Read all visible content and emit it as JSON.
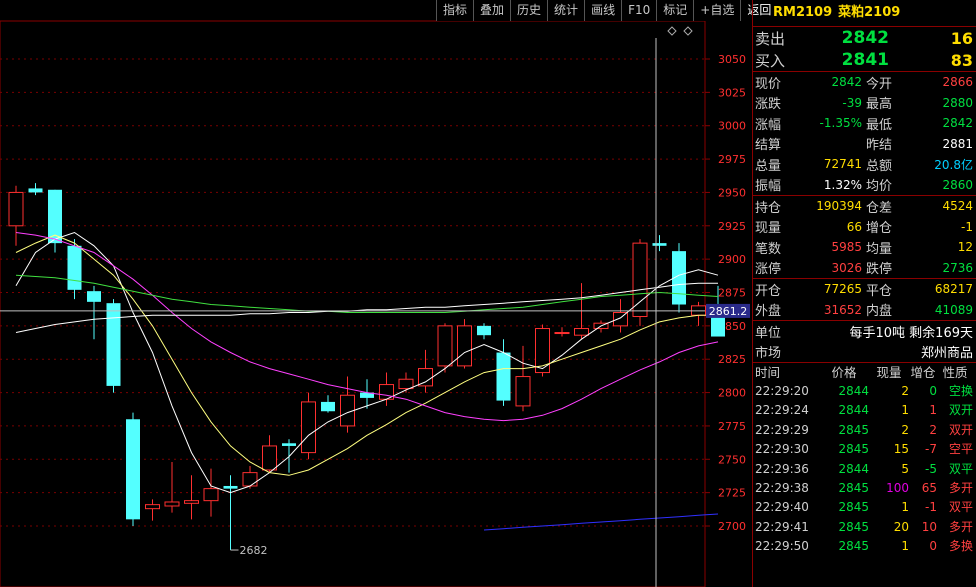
{
  "toolbar": [
    {
      "label": "指标"
    },
    {
      "label": "叠加"
    },
    {
      "label": "历史"
    },
    {
      "label": "统计"
    },
    {
      "label": "画线"
    },
    {
      "label": "F10"
    },
    {
      "label": "标记"
    },
    {
      "label": "+自选"
    },
    {
      "label": "返回"
    }
  ],
  "contract": {
    "code": "RM2109",
    "name": "菜粕2109"
  },
  "chart_data": {
    "type": "candlestick",
    "ylim": [
      2682,
      3070
    ],
    "yticks": [
      3050,
      3025,
      3000,
      2975,
      2950,
      2925,
      2900,
      2875,
      2850,
      2825,
      2800,
      2775,
      2750,
      2725,
      2700
    ],
    "price_tag": "2861.2",
    "price_line": 2861.2,
    "low_annotation": "2682",
    "candles": [
      {
        "o": 2925,
        "h": 2955,
        "l": 2910,
        "c": 2950
      },
      {
        "o": 2953,
        "h": 2957,
        "l": 2948,
        "c": 2950
      },
      {
        "o": 2952,
        "h": 2952,
        "l": 2905,
        "c": 2912
      },
      {
        "o": 2910,
        "h": 2915,
        "l": 2870,
        "c": 2877
      },
      {
        "o": 2876,
        "h": 2880,
        "l": 2840,
        "c": 2868
      },
      {
        "o": 2867,
        "h": 2870,
        "l": 2800,
        "c": 2805
      },
      {
        "o": 2780,
        "h": 2785,
        "l": 2700,
        "c": 2705
      },
      {
        "o": 2713,
        "h": 2720,
        "l": 2704,
        "c": 2716
      },
      {
        "o": 2715,
        "h": 2748,
        "l": 2710,
        "c": 2718
      },
      {
        "o": 2717,
        "h": 2738,
        "l": 2705,
        "c": 2719
      },
      {
        "o": 2719,
        "h": 2743,
        "l": 2707,
        "c": 2728
      },
      {
        "o": 2730,
        "h": 2738,
        "l": 2682,
        "c": 2728
      },
      {
        "o": 2730,
        "h": 2745,
        "l": 2728,
        "c": 2740
      },
      {
        "o": 2742,
        "h": 2768,
        "l": 2740,
        "c": 2760
      },
      {
        "o": 2762,
        "h": 2765,
        "l": 2740,
        "c": 2760
      },
      {
        "o": 2755,
        "h": 2800,
        "l": 2750,
        "c": 2793
      },
      {
        "o": 2793,
        "h": 2798,
        "l": 2785,
        "c": 2786
      },
      {
        "o": 2775,
        "h": 2812,
        "l": 2770,
        "c": 2798
      },
      {
        "o": 2800,
        "h": 2810,
        "l": 2788,
        "c": 2796
      },
      {
        "o": 2795,
        "h": 2815,
        "l": 2790,
        "c": 2806
      },
      {
        "o": 2803,
        "h": 2815,
        "l": 2800,
        "c": 2810
      },
      {
        "o": 2805,
        "h": 2832,
        "l": 2800,
        "c": 2818
      },
      {
        "o": 2820,
        "h": 2852,
        "l": 2815,
        "c": 2850
      },
      {
        "o": 2820,
        "h": 2855,
        "l": 2818,
        "c": 2850
      },
      {
        "o": 2850,
        "h": 2852,
        "l": 2840,
        "c": 2843
      },
      {
        "o": 2830,
        "h": 2840,
        "l": 2790,
        "c": 2794
      },
      {
        "o": 2790,
        "h": 2835,
        "l": 2786,
        "c": 2812
      },
      {
        "o": 2815,
        "h": 2851,
        "l": 2812,
        "c": 2848
      },
      {
        "o": 2845,
        "h": 2849,
        "l": 2842,
        "c": 2845
      },
      {
        "o": 2843,
        "h": 2882,
        "l": 2840,
        "c": 2848
      },
      {
        "o": 2848,
        "h": 2854,
        "l": 2845,
        "c": 2852
      },
      {
        "o": 2850,
        "h": 2870,
        "l": 2845,
        "c": 2860
      },
      {
        "o": 2857,
        "h": 2915,
        "l": 2850,
        "c": 2912
      },
      {
        "o": 2912,
        "h": 2918,
        "l": 2906,
        "c": 2910
      },
      {
        "o": 2906,
        "h": 2912,
        "l": 2860,
        "c": 2866
      },
      {
        "o": 2858,
        "h": 2868,
        "l": 2850,
        "c": 2865
      },
      {
        "o": 2866,
        "h": 2880,
        "l": 2842,
        "c": 2842
      }
    ],
    "ma_series": [
      {
        "color": "#ffffff",
        "values": [
          2880,
          2905,
          2915,
          2920,
          2910,
          2895,
          2860,
          2830,
          2790,
          2755,
          2730,
          2725,
          2730,
          2740,
          2752,
          2768,
          2778,
          2785,
          2790,
          2795,
          2802,
          2808,
          2818,
          2830,
          2836,
          2830,
          2822,
          2818,
          2828,
          2840,
          2850,
          2856,
          2868,
          2880,
          2888,
          2892,
          2888
        ]
      },
      {
        "color": "#ffff80",
        "values": [
          2905,
          2912,
          2918,
          2912,
          2900,
          2888,
          2870,
          2850,
          2825,
          2800,
          2778,
          2760,
          2748,
          2740,
          2738,
          2742,
          2750,
          2758,
          2768,
          2776,
          2785,
          2792,
          2800,
          2808,
          2815,
          2818,
          2818,
          2820,
          2825,
          2830,
          2835,
          2840,
          2847,
          2853,
          2856,
          2858,
          2858
        ]
      },
      {
        "color": "#ff40ff",
        "values": [
          2920,
          2918,
          2915,
          2910,
          2905,
          2895,
          2885,
          2873,
          2860,
          2848,
          2838,
          2830,
          2823,
          2818,
          2814,
          2810,
          2806,
          2803,
          2800,
          2798,
          2795,
          2790,
          2785,
          2782,
          2780,
          2779,
          2780,
          2783,
          2788,
          2795,
          2803,
          2810,
          2817,
          2823,
          2830,
          2835,
          2838
        ]
      },
      {
        "color": "#40e040",
        "values": [
          2888,
          2887,
          2886,
          2884,
          2882,
          2879,
          2876,
          2873,
          2870,
          2868,
          2866,
          2865,
          2864,
          2863,
          2862,
          2861,
          2861,
          2860,
          2860,
          2860,
          2860,
          2860,
          2860,
          2861,
          2862,
          2863,
          2864,
          2866,
          2868,
          2870,
          2872,
          2873,
          2874,
          2875,
          2874,
          2873,
          2872
        ]
      },
      {
        "color": "#ffffff",
        "values": [
          2845,
          2848,
          2851,
          2853,
          2855,
          2856,
          2857,
          2858,
          2858,
          2858,
          2858,
          2858,
          2859,
          2859,
          2860,
          2860,
          2861,
          2861,
          2862,
          2862,
          2863,
          2864,
          2864,
          2865,
          2866,
          2867,
          2868,
          2869,
          2870,
          2871,
          2873,
          2875,
          2877,
          2879,
          2881,
          2882,
          2882
        ]
      },
      {
        "color": "#3030ff",
        "values": [
          null,
          null,
          null,
          null,
          null,
          null,
          null,
          null,
          null,
          null,
          null,
          null,
          null,
          null,
          null,
          null,
          null,
          null,
          null,
          null,
          null,
          null,
          null,
          null,
          2697,
          2698,
          2699,
          2700,
          2701,
          2702,
          2703,
          2704,
          2705,
          2706,
          2707,
          2708,
          2709
        ]
      }
    ]
  },
  "quote": {
    "sell": {
      "label": "卖出",
      "price": "2842",
      "vol": "16"
    },
    "buy": {
      "label": "买入",
      "price": "2841",
      "vol": "83"
    },
    "stats": [
      {
        "l1": "现价",
        "v1": "2842",
        "c1": "g",
        "l2": "今开",
        "v2": "2866",
        "c2": "r"
      },
      {
        "l1": "涨跌",
        "v1": "-39",
        "c1": "g",
        "l2": "最高",
        "v2": "2880",
        "c2": "g"
      },
      {
        "l1": "涨幅",
        "v1": "-1.35%",
        "c1": "g",
        "l2": "最低",
        "v2": "2842",
        "c2": "g"
      },
      {
        "l1": "结算",
        "v1": "",
        "c1": "w",
        "l2": "昨结",
        "v2": "2881",
        "c2": "w"
      },
      {
        "l1": "总量",
        "v1": "72741",
        "c1": "y",
        "l2": "总额",
        "v2": "20.8亿",
        "c2": "c"
      },
      {
        "l1": "振幅",
        "v1": "1.32%",
        "c1": "w",
        "l2": "均价",
        "v2": "2860",
        "c2": "g"
      }
    ],
    "positions": [
      {
        "l1": "持仓",
        "v1": "190394",
        "c1": "y",
        "l2": "仓差",
        "v2": "4524",
        "c2": "y"
      },
      {
        "l1": "现量",
        "v1": "66",
        "c1": "y",
        "l2": "增仓",
        "v2": "-1",
        "c2": "y"
      },
      {
        "l1": "笔数",
        "v1": "5985",
        "c1": "r",
        "l2": "均量",
        "v2": "12",
        "c2": "y"
      },
      {
        "l1": "涨停",
        "v1": "3026",
        "c1": "r",
        "l2": "跌停",
        "v2": "2736",
        "c2": "g"
      }
    ],
    "openclose": [
      {
        "l1": "开仓",
        "v1": "77265",
        "c1": "y",
        "l2": "平仓",
        "v2": "68217",
        "c2": "y"
      },
      {
        "l1": "外盘",
        "v1": "31652",
        "c1": "r",
        "l2": "内盘",
        "v2": "41089",
        "c2": "g"
      }
    ],
    "unit": {
      "label": "单位",
      "value": "每手10吨 剩余169天"
    },
    "market": {
      "label": "市场",
      "value": "郑州商品"
    }
  },
  "ticks": {
    "headers": {
      "time": "时间",
      "price": "价格",
      "vol": "现量",
      "chg": "增仓",
      "nature": "性质"
    },
    "rows": [
      {
        "time": "22:29:20",
        "price": "2844",
        "vol": "2",
        "vc": "y",
        "chg": "0",
        "cc": "g",
        "nature": "空换",
        "nc": "g"
      },
      {
        "time": "22:29:24",
        "price": "2844",
        "vol": "1",
        "vc": "y",
        "chg": "1",
        "cc": "r",
        "nature": "双开",
        "nc": "g"
      },
      {
        "time": "22:29:29",
        "price": "2845",
        "vol": "2",
        "vc": "y",
        "chg": "2",
        "cc": "r",
        "nature": "双开",
        "nc": "r"
      },
      {
        "time": "22:29:30",
        "price": "2845",
        "vol": "15",
        "vc": "y",
        "chg": "-7",
        "cc": "r",
        "nature": "空平",
        "nc": "r"
      },
      {
        "time": "22:29:36",
        "price": "2844",
        "vol": "5",
        "vc": "y",
        "chg": "-5",
        "cc": "g",
        "nature": "双平",
        "nc": "g"
      },
      {
        "time": "22:29:38",
        "price": "2845",
        "vol": "100",
        "vc": "m",
        "chg": "65",
        "cc": "r",
        "nature": "多开",
        "nc": "r"
      },
      {
        "time": "22:29:40",
        "price": "2845",
        "vol": "1",
        "vc": "y",
        "chg": "-1",
        "cc": "r",
        "nature": "双平",
        "nc": "r"
      },
      {
        "time": "22:29:41",
        "price": "2845",
        "vol": "20",
        "vc": "y",
        "chg": "10",
        "cc": "r",
        "nature": "多开",
        "nc": "r"
      },
      {
        "time": "22:29:50",
        "price": "2845",
        "vol": "1",
        "vc": "y",
        "chg": "0",
        "cc": "r",
        "nature": "多换",
        "nc": "r"
      }
    ]
  }
}
